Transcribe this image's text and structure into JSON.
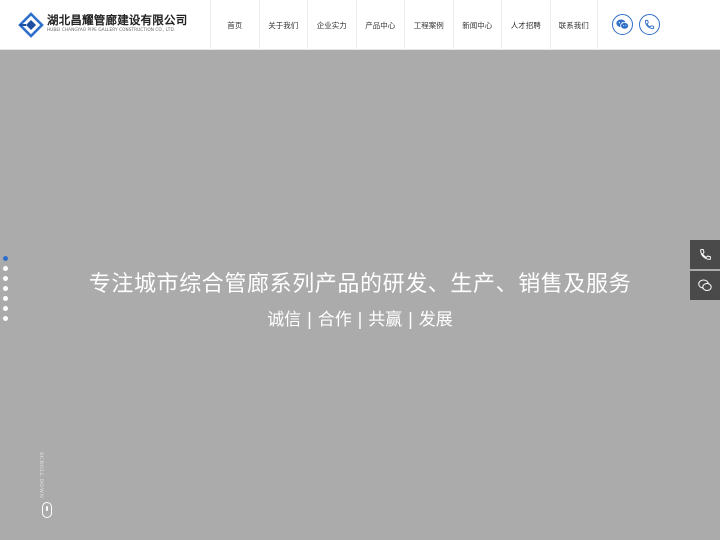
{
  "brand": {
    "name": "湖北昌耀管廊建设有限公司",
    "name_en": "HUBEI CHANGYAO PIPE GALLERY CONSTRUCTION CO., LTD.",
    "accent_color": "#2f6fc9"
  },
  "nav": {
    "items": [
      {
        "label": "首页"
      },
      {
        "label": "关于我们"
      },
      {
        "label": "企业实力"
      },
      {
        "label": "产品中心"
      },
      {
        "label": "工程案例"
      },
      {
        "label": "新闻中心"
      },
      {
        "label": "人才招聘"
      },
      {
        "label": "联系我们"
      }
    ]
  },
  "header_icons": [
    "wechat-icon",
    "phone-icon"
  ],
  "hero": {
    "title": "专注城市综合管廊系列产品的研发、生产、销售及服务",
    "subtitle": "诚信 | 合作 | 共赢 | 发展",
    "background_color": "#ababab"
  },
  "pager": {
    "count": 7,
    "active_index": 0
  },
  "scroll_hint": "SCROLL DOWN",
  "float_bar": {
    "icons": [
      "phone-icon",
      "chat-icon"
    ]
  }
}
